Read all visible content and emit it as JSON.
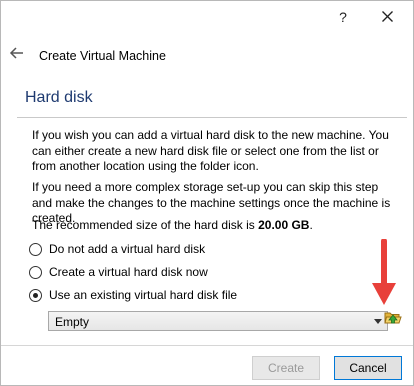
{
  "titlebar": {
    "help_label": "?",
    "close_icon": "close-icon"
  },
  "header": {
    "back_icon": "back-arrow-icon",
    "title": "Create Virtual Machine"
  },
  "section": {
    "title": "Hard disk"
  },
  "body": {
    "paragraph1": "If you wish you can add a virtual hard disk to the new machine. You can either create a new hard disk file or select one from the list or from another location using the folder icon.",
    "paragraph2": "If you need a more complex storage set-up you can skip this step and make the changes to the machine settings once the machine is created.",
    "recommended_prefix": "The recommended size of the hard disk is ",
    "recommended_size": "20.00 GB",
    "recommended_suffix": "."
  },
  "options": [
    {
      "label": "Do not add a virtual hard disk",
      "selected": false
    },
    {
      "label": "Create a virtual hard disk now",
      "selected": false
    },
    {
      "label": "Use an existing virtual hard disk file",
      "selected": true
    }
  ],
  "disk_select": {
    "value": "Empty"
  },
  "folder_button": {
    "icon": "folder-open-icon"
  },
  "annotation": {
    "icon": "red-arrow-icon",
    "color": "#e8403a"
  },
  "footer": {
    "create_label": "Create",
    "cancel_label": "Cancel"
  }
}
